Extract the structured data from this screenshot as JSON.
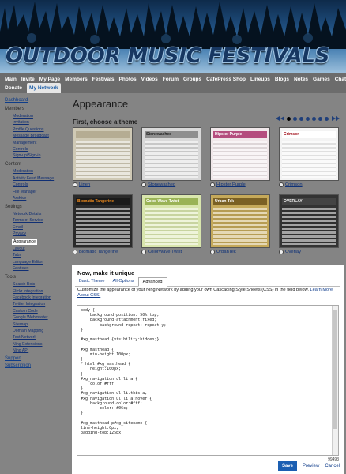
{
  "banner": {
    "title": "Outdoor Music Festivals"
  },
  "nav": {
    "row1": [
      "Main",
      "Invite",
      "My Page",
      "Members",
      "Festivals",
      "Photos",
      "Videos",
      "Forum",
      "Groups",
      "CafePress Shop",
      "Lineups",
      "Blogs",
      "Notes",
      "Games",
      "Chat"
    ],
    "row2": [
      "Donate",
      "My Network"
    ]
  },
  "sidebar": {
    "dashboard": "Dashboard",
    "members_title": "Members",
    "members": [
      "Moderation",
      "Invitation",
      "Profile Questions",
      "Message Broadcast",
      "Management",
      "Controls",
      "Sign-up/Sign-in"
    ],
    "content_title": "Content",
    "content": [
      "Moderation",
      "Activity Feed Message",
      "Controls",
      "File Manager",
      "Archive"
    ],
    "settings_title": "Settings",
    "settings": [
      "Network Details",
      "Terms of Service",
      "Email",
      "Privacy",
      "Appearance",
      "Layout",
      "Tabs",
      "Language Editor",
      "Features"
    ],
    "tools_title": "Tools",
    "tools": [
      "Search Bots",
      "Flickr Integration",
      "Facebook Integration",
      "Twitter Integration",
      "Custom Code",
      "Google Webmaster",
      "Sitemap",
      "Domain Mapping",
      "Test Network",
      "Ning Extensions",
      "Ning API"
    ],
    "support": "Support",
    "subscription": "Subscription"
  },
  "main": {
    "title": "Appearance",
    "choose": "First, choose a theme",
    "themes": [
      {
        "name": "Linen",
        "header": "",
        "bg": "#cfc9b5",
        "bar": "#b5ac93",
        "fg": "#555"
      },
      {
        "name": "Stonewashed",
        "header": "Stonewashed",
        "bg": "#d9d9d9",
        "bar": "#8f8f8f",
        "fg": "#222"
      },
      {
        "name": "Hipster Purple",
        "header": "Hipster Purple",
        "bg": "#f0e8ea",
        "bar": "#b44d7e",
        "fg": "#fff"
      },
      {
        "name": "Crimson",
        "header": "Crimson",
        "bg": "#f3f3f3",
        "bar": "#ffffff",
        "fg": "#a3141e"
      },
      {
        "name": "Biomatic Tangerine",
        "header": "Biomatic Tangerine",
        "bg": "#2a2a2a",
        "bar": "#1a1a1a",
        "fg": "#f28c1c"
      },
      {
        "name": "ColorWave Twist",
        "header": "Color Wave Twist",
        "bg": "#d9e6ad",
        "bar": "#9ab356",
        "fg": "#fff"
      },
      {
        "name": "UrbanTek",
        "header": "Urban Tek",
        "bg": "#c5a95a",
        "bar": "#7a6024",
        "fg": "#fff"
      },
      {
        "name": "Overlay",
        "header": "OVERLAY",
        "bg": "#333",
        "bar": "#444",
        "fg": "#eee"
      }
    ],
    "page_dots": 7,
    "active_dot": 0
  },
  "panel": {
    "title": "Now, make it unique",
    "tabs": [
      "Basic Theme",
      "All Options",
      "Advanced"
    ],
    "active_tab": "Advanced",
    "description": "Customize the appearance of your Ning Network by adding your own Cascading Style Sheets (CSS) in the field below.",
    "learn_more": "Learn More About CSS.",
    "css": "body {\n    background-position: 50% top;\n    background-attachment:fixed;\n        background-repeat: repeat-y;\n}\n\n#xg_masthead {visibility:hidden;}\n\n#xg_masthead {\n    min-height:100px;\n}\n* html #xg_masthead {\n    height:100px;\n}\n#xg_navigation ul li a {\n    color:#fff;\n}\n#xg_navigation ul li.this a,\n#xg_navigation ul li a:hover {\n    background-color:#fff;\n        color: #06c;\n}\n\n#xg_masthead p#xg_sitename {\nline-height:0px;\npadding-top:125px;",
    "char_count": "99493",
    "save": "Save",
    "preview": "Preview",
    "cancel": "Cancel"
  }
}
